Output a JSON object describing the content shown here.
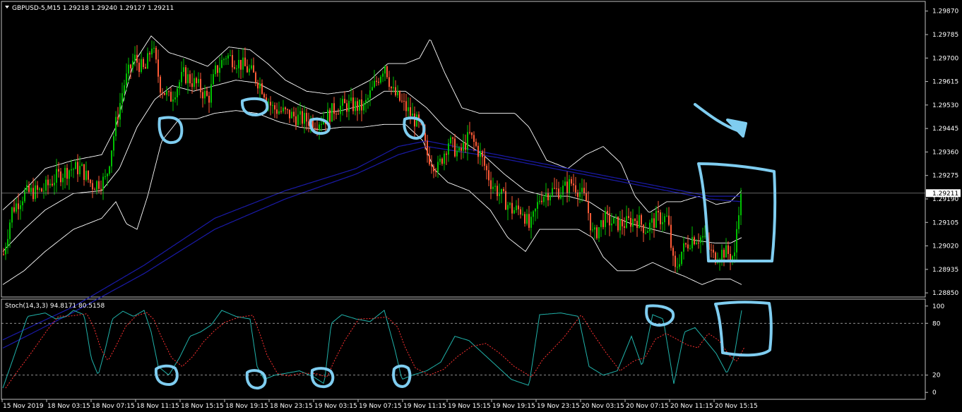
{
  "chart_data": {
    "type": "candlestick",
    "main": {
      "header": "GBPUSD-5,M15  1.29218 1.29240 1.29127 1.29211",
      "price_labels": [
        "1.29870",
        "1.29785",
        "1.29700",
        "1.29615",
        "1.29530",
        "1.29445",
        "1.29360",
        "1.29275",
        "1.29190",
        "1.29105",
        "1.29020",
        "1.28935",
        "1.28850"
      ],
      "price_values": [
        1.2987,
        1.29785,
        1.297,
        1.29615,
        1.2953,
        1.29445,
        1.2936,
        1.29275,
        1.2919,
        1.29105,
        1.2902,
        1.28935,
        1.2885
      ],
      "current_price_label": "1.29211",
      "current_price": 1.29211,
      "ylim": [
        1.28835,
        1.29905
      ],
      "approx_close_path": [
        [
          0,
          1.2899
        ],
        [
          12,
          1.2915
        ],
        [
          30,
          1.2921
        ],
        [
          55,
          1.2922
        ],
        [
          75,
          1.2927
        ],
        [
          95,
          1.293
        ],
        [
          110,
          1.293
        ],
        [
          125,
          1.2924
        ],
        [
          145,
          1.2926
        ],
        [
          158,
          1.2945
        ],
        [
          170,
          1.296
        ],
        [
          185,
          1.297
        ],
        [
          200,
          1.2965
        ],
        [
          210,
          1.2975
        ],
        [
          222,
          1.296
        ],
        [
          235,
          1.2955
        ],
        [
          255,
          1.2964
        ],
        [
          275,
          1.296
        ],
        [
          290,
          1.2955
        ],
        [
          300,
          1.2965
        ],
        [
          315,
          1.2971
        ],
        [
          335,
          1.2968
        ],
        [
          350,
          1.2965
        ],
        [
          365,
          1.296
        ],
        [
          380,
          1.2952
        ],
        [
          400,
          1.295
        ],
        [
          420,
          1.2948
        ],
        [
          440,
          1.2947
        ],
        [
          455,
          1.2948
        ],
        [
          470,
          1.2952
        ],
        [
          490,
          1.2953
        ],
        [
          510,
          1.2952
        ],
        [
          525,
          1.296
        ],
        [
          540,
          1.2968
        ],
        [
          550,
          1.2958
        ],
        [
          560,
          1.2955
        ],
        [
          575,
          1.295
        ],
        [
          590,
          1.2945
        ],
        [
          600,
          1.2935
        ],
        [
          615,
          1.293
        ],
        [
          630,
          1.294
        ],
        [
          645,
          1.2935
        ],
        [
          660,
          1.2942
        ],
        [
          675,
          1.2935
        ],
        [
          690,
          1.2925
        ],
        [
          705,
          1.292
        ],
        [
          720,
          1.2915
        ],
        [
          735,
          1.2915
        ],
        [
          745,
          1.2908
        ],
        [
          760,
          1.292
        ],
        [
          775,
          1.2922
        ],
        [
          790,
          1.2922
        ],
        [
          805,
          1.2925
        ],
        [
          815,
          1.2922
        ],
        [
          825,
          1.2918
        ],
        [
          835,
          1.2905
        ],
        [
          850,
          1.2912
        ],
        [
          865,
          1.291
        ],
        [
          880,
          1.291
        ],
        [
          895,
          1.2912
        ],
        [
          910,
          1.2908
        ],
        [
          925,
          1.2912
        ],
        [
          940,
          1.2912
        ],
        [
          950,
          1.2892
        ],
        [
          960,
          1.29
        ],
        [
          975,
          1.2905
        ],
        [
          990,
          1.2905
        ],
        [
          1005,
          1.2898
        ],
        [
          1020,
          1.29
        ],
        [
          1035,
          1.2898
        ],
        [
          1040,
          1.2915
        ],
        [
          1046,
          1.2921
        ]
      ],
      "bb_upper_path": [
        [
          0,
          1.2915
        ],
        [
          30,
          1.2922
        ],
        [
          60,
          1.293
        ],
        [
          100,
          1.2933
        ],
        [
          140,
          1.2935
        ],
        [
          160,
          1.2945
        ],
        [
          185,
          1.2968
        ],
        [
          210,
          1.2978
        ],
        [
          235,
          1.2972
        ],
        [
          260,
          1.297
        ],
        [
          290,
          1.2967
        ],
        [
          320,
          1.2974
        ],
        [
          350,
          1.2973
        ],
        [
          375,
          1.2968
        ],
        [
          400,
          1.2962
        ],
        [
          430,
          1.2958
        ],
        [
          460,
          1.2957
        ],
        [
          490,
          1.2958
        ],
        [
          520,
          1.2962
        ],
        [
          545,
          1.2968
        ],
        [
          570,
          1.2968
        ],
        [
          590,
          1.297
        ],
        [
          605,
          1.2977
        ],
        [
          625,
          1.2965
        ],
        [
          650,
          1.2952
        ],
        [
          675,
          1.295
        ],
        [
          700,
          1.295
        ],
        [
          725,
          1.295
        ],
        [
          745,
          1.2945
        ],
        [
          770,
          1.2933
        ],
        [
          800,
          1.293
        ],
        [
          825,
          1.2935
        ],
        [
          850,
          1.2938
        ],
        [
          875,
          1.2932
        ],
        [
          895,
          1.292
        ],
        [
          915,
          1.2914
        ],
        [
          940,
          1.2918
        ],
        [
          960,
          1.2918
        ],
        [
          985,
          1.292
        ],
        [
          1010,
          1.2917
        ],
        [
          1030,
          1.2918
        ],
        [
          1046,
          1.2922
        ]
      ],
      "bb_middle_path": [
        [
          0,
          1.29
        ],
        [
          30,
          1.2908
        ],
        [
          60,
          1.2915
        ],
        [
          100,
          1.2921
        ],
        [
          140,
          1.2922
        ],
        [
          165,
          1.293
        ],
        [
          190,
          1.2945
        ],
        [
          215,
          1.2955
        ],
        [
          240,
          1.296
        ],
        [
          270,
          1.2958
        ],
        [
          300,
          1.296
        ],
        [
          330,
          1.2962
        ],
        [
          360,
          1.2961
        ],
        [
          390,
          1.2957
        ],
        [
          420,
          1.2953
        ],
        [
          450,
          1.295
        ],
        [
          480,
          1.2951
        ],
        [
          510,
          1.2953
        ],
        [
          540,
          1.2958
        ],
        [
          570,
          1.2958
        ],
        [
          600,
          1.2952
        ],
        [
          625,
          1.2945
        ],
        [
          650,
          1.294
        ],
        [
          680,
          1.2935
        ],
        [
          710,
          1.2928
        ],
        [
          740,
          1.2922
        ],
        [
          770,
          1.292
        ],
        [
          800,
          1.292
        ],
        [
          830,
          1.2918
        ],
        [
          860,
          1.2913
        ],
        [
          890,
          1.291
        ],
        [
          920,
          1.2908
        ],
        [
          950,
          1.2906
        ],
        [
          980,
          1.2904
        ],
        [
          1010,
          1.2903
        ],
        [
          1030,
          1.2903
        ],
        [
          1046,
          1.2905
        ]
      ],
      "bb_lower_path": [
        [
          0,
          1.2888
        ],
        [
          30,
          1.2893
        ],
        [
          60,
          1.29
        ],
        [
          100,
          1.2908
        ],
        [
          140,
          1.2912
        ],
        [
          160,
          1.2918
        ],
        [
          175,
          1.291
        ],
        [
          190,
          1.2908
        ],
        [
          205,
          1.292
        ],
        [
          225,
          1.294
        ],
        [
          250,
          1.2948
        ],
        [
          275,
          1.2948
        ],
        [
          300,
          1.295
        ],
        [
          330,
          1.2951
        ],
        [
          360,
          1.295
        ],
        [
          390,
          1.2947
        ],
        [
          420,
          1.2945
        ],
        [
          450,
          1.2944
        ],
        [
          480,
          1.2945
        ],
        [
          510,
          1.2945
        ],
        [
          540,
          1.2946
        ],
        [
          570,
          1.2946
        ],
        [
          595,
          1.294
        ],
        [
          610,
          1.293
        ],
        [
          630,
          1.2925
        ],
        [
          660,
          1.2922
        ],
        [
          690,
          1.2915
        ],
        [
          715,
          1.2905
        ],
        [
          740,
          1.29
        ],
        [
          760,
          1.2908
        ],
        [
          790,
          1.2908
        ],
        [
          815,
          1.2908
        ],
        [
          835,
          1.2905
        ],
        [
          850,
          1.2898
        ],
        [
          870,
          1.2893
        ],
        [
          895,
          1.2893
        ],
        [
          920,
          1.2896
        ],
        [
          945,
          1.2893
        ],
        [
          965,
          1.2891
        ],
        [
          990,
          1.2888
        ],
        [
          1010,
          1.289
        ],
        [
          1030,
          1.289
        ],
        [
          1046,
          1.2888
        ]
      ],
      "ma_fast_path": [
        [
          0,
          1.2868
        ],
        [
          100,
          1.288
        ],
        [
          200,
          1.2895
        ],
        [
          300,
          1.2912
        ],
        [
          400,
          1.2922
        ],
        [
          500,
          1.293
        ],
        [
          560,
          1.2938
        ],
        [
          600,
          1.294
        ],
        [
          700,
          1.2935
        ],
        [
          800,
          1.293
        ],
        [
          900,
          1.2925
        ],
        [
          1000,
          1.292
        ],
        [
          1046,
          1.292
        ]
      ],
      "ma_slow_path": [
        [
          0,
          1.2865
        ],
        [
          100,
          1.2878
        ],
        [
          200,
          1.2892
        ],
        [
          300,
          1.2908
        ],
        [
          400,
          1.2919
        ],
        [
          500,
          1.2928
        ],
        [
          560,
          1.2935
        ],
        [
          600,
          1.2938
        ],
        [
          700,
          1.2934
        ],
        [
          800,
          1.2929
        ],
        [
          900,
          1.2924
        ],
        [
          1000,
          1.2919
        ],
        [
          1046,
          1.2918
        ]
      ]
    },
    "stochastic": {
      "header": "Stoch(14,3,3) 94.8171 80.5158",
      "k_value": 94.8171,
      "d_value": 80.5158,
      "levels": [
        80,
        20
      ],
      "level_labels": [
        "100",
        "80",
        "20",
        "0"
      ],
      "level_values": [
        100,
        80,
        20,
        0
      ],
      "ylim": [
        -8,
        108
      ],
      "approx_k_path": [
        [
          0,
          5
        ],
        [
          15,
          40
        ],
        [
          35,
          88
        ],
        [
          60,
          92
        ],
        [
          75,
          85
        ],
        [
          90,
          88
        ],
        [
          100,
          95
        ],
        [
          115,
          90
        ],
        [
          125,
          40
        ],
        [
          135,
          20
        ],
        [
          145,
          50
        ],
        [
          155,
          85
        ],
        [
          170,
          94
        ],
        [
          185,
          88
        ],
        [
          200,
          95
        ],
        [
          210,
          70
        ],
        [
          220,
          30
        ],
        [
          235,
          20
        ],
        [
          250,
          40
        ],
        [
          265,
          65
        ],
        [
          280,
          70
        ],
        [
          295,
          78
        ],
        [
          310,
          95
        ],
        [
          330,
          88
        ],
        [
          350,
          85
        ],
        [
          360,
          30
        ],
        [
          370,
          15
        ],
        [
          385,
          20
        ],
        [
          400,
          22
        ],
        [
          420,
          25
        ],
        [
          440,
          18
        ],
        [
          455,
          10
        ],
        [
          465,
          80
        ],
        [
          480,
          90
        ],
        [
          500,
          85
        ],
        [
          520,
          82
        ],
        [
          540,
          95
        ],
        [
          555,
          50
        ],
        [
          565,
          15
        ],
        [
          580,
          20
        ],
        [
          600,
          25
        ],
        [
          620,
          35
        ],
        [
          640,
          65
        ],
        [
          660,
          60
        ],
        [
          680,
          45
        ],
        [
          700,
          30
        ],
        [
          720,
          15
        ],
        [
          745,
          8
        ],
        [
          760,
          90
        ],
        [
          790,
          92
        ],
        [
          815,
          88
        ],
        [
          830,
          30
        ],
        [
          850,
          20
        ],
        [
          870,
          25
        ],
        [
          890,
          65
        ],
        [
          905,
          30
        ],
        [
          920,
          90
        ],
        [
          935,
          85
        ],
        [
          950,
          10
        ],
        [
          965,
          70
        ],
        [
          980,
          75
        ],
        [
          995,
          60
        ],
        [
          1010,
          45
        ],
        [
          1025,
          22
        ],
        [
          1035,
          40
        ],
        [
          1046,
          95
        ]
      ]
    },
    "time_labels": [
      "15 Nov 2019",
      "18 Nov 03:15",
      "18 Nov 07:15",
      "18 Nov 11:15",
      "18 Nov 15:15",
      "18 Nov 19:15",
      "18 Nov 23:15",
      "19 Nov 03:15",
      "19 Nov 07:15",
      "19 Nov 11:15",
      "19 Nov 15:15",
      "19 Nov 19:15",
      "19 Nov 23:15",
      "20 Nov 03:15",
      "20 Nov 07:15",
      "20 Nov 11:15",
      "20 Nov 15:15"
    ],
    "colors": {
      "background": "#000000",
      "bull_candle": "#00c000",
      "bear_candle": "#ff5a36",
      "bands": "#ffffff",
      "ma": "#1a1aa8",
      "stoch_k": "#20b2aa",
      "stoch_d": "#ff3030",
      "annotation": "#7fcdf0",
      "text": "#ffffff"
    }
  }
}
